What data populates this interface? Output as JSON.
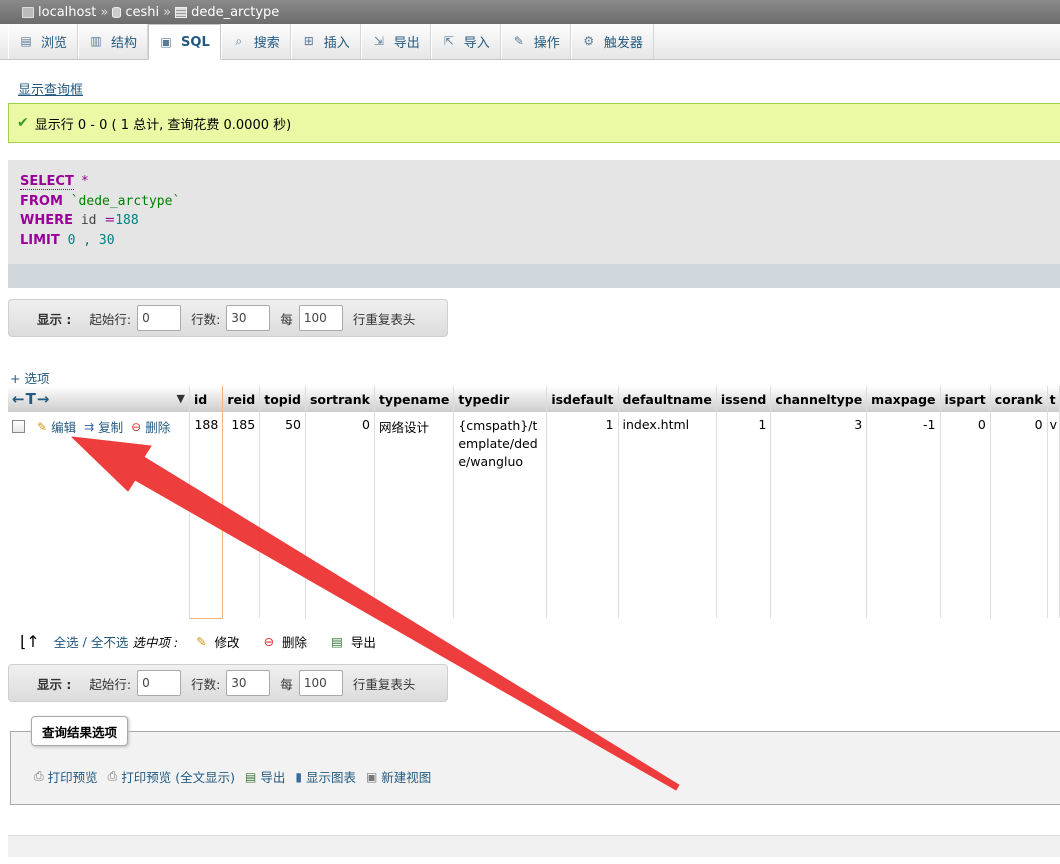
{
  "breadcrumb": {
    "server": "localhost",
    "database": "ceshi",
    "table": "dede_arctype",
    "separator": "»"
  },
  "tabs": [
    {
      "label": "浏览",
      "icon": "browse-icon"
    },
    {
      "label": "结构",
      "icon": "structure-icon"
    },
    {
      "label": "SQL",
      "icon": "sql-icon",
      "active": true
    },
    {
      "label": "搜索",
      "icon": "search-icon"
    },
    {
      "label": "插入",
      "icon": "insert-icon"
    },
    {
      "label": "导出",
      "icon": "export-icon"
    },
    {
      "label": "导入",
      "icon": "import-icon"
    },
    {
      "label": "操作",
      "icon": "wrench-icon"
    },
    {
      "label": "触发器",
      "icon": "trigger-icon"
    }
  ],
  "show_query_box": "显示查询框",
  "success_message": "显示行 0 - 0 ( 1 总计, 查询花费 0.0000 秒)",
  "sql": {
    "select": "SELECT",
    "star": "*",
    "from": "FROM",
    "table": "`dede_arctype`",
    "where": "WHERE",
    "where_col": "id",
    "where_op": "=",
    "where_val": "188",
    "limit": "LIMIT",
    "limit_start": "0",
    "limit_comma": ",",
    "limit_count": "30"
  },
  "nav": {
    "show_label": "显示 :",
    "start_label": "起始行:",
    "start_value": "0",
    "rows_label": "行数:",
    "rows_value": "30",
    "every_label": "每",
    "every_value": "100",
    "repeat_label": "行重复表头"
  },
  "options_link": "+ 选项",
  "table": {
    "arrows": "←T→",
    "columns": [
      "id",
      "reid",
      "topid",
      "sortrank",
      "typename",
      "typedir",
      "isdefault",
      "defaultname",
      "issend",
      "channeltype",
      "maxpage",
      "ispart",
      "corank",
      "t"
    ],
    "row": {
      "actions": {
        "edit": "编辑",
        "copy": "复制",
        "delete": "删除"
      },
      "id": "188",
      "reid": "185",
      "topid": "50",
      "sortrank": "0",
      "typename": "网络设计",
      "typedir": "{cmspath}/template/dede/wangluo",
      "isdefault": "1",
      "defaultname": "index.html",
      "issend": "1",
      "channeltype": "3",
      "maxpage": "-1",
      "ispart": "0",
      "corank": "0",
      "t": "v"
    }
  },
  "bulk": {
    "check_all": "全选",
    "slash": "/",
    "uncheck_all": "全不选",
    "with_selected": "选中项 :",
    "edit": "修改",
    "delete": "删除",
    "export": "导出"
  },
  "query_results_ops": {
    "legend": "查询结果选项",
    "items": [
      "打印预览",
      "打印预览 (全文显示)",
      "导出",
      "显示图表",
      "新建视图"
    ]
  },
  "colors": {
    "link": "#235a81",
    "success_bg": "#ebf8a4",
    "keyword": "#990099",
    "annotation_arrow": "#ee3333"
  }
}
